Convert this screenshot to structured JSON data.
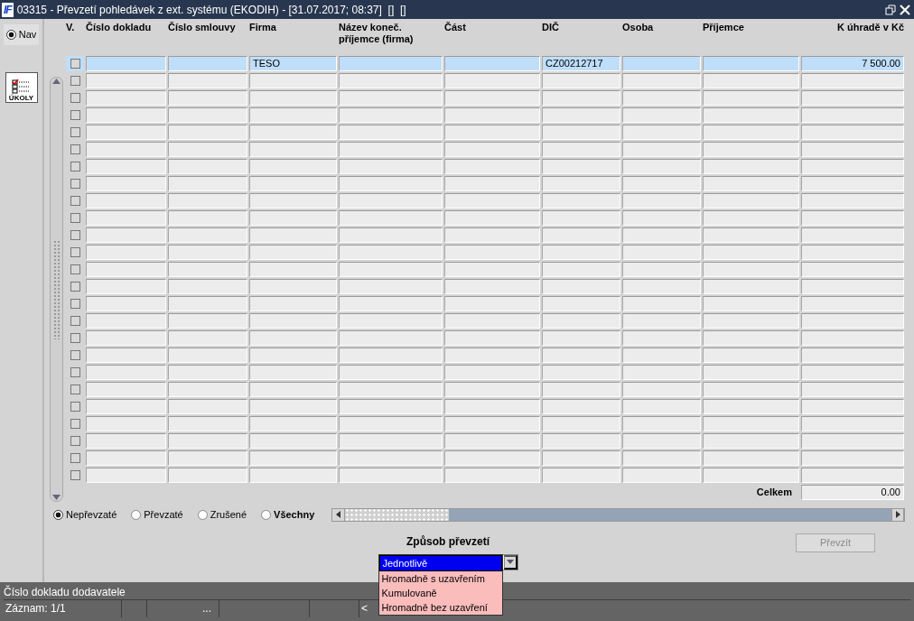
{
  "window": {
    "logo": "IF",
    "title": "03315 - Převzetí pohledávek z ext. systému (EKODIH) - [31.07.2017; 08:37]  []  []"
  },
  "sidebar": {
    "nav_radio": {
      "label": "Nav",
      "selected": true
    },
    "tasks_button": {
      "label": "ÚKOLY"
    }
  },
  "table": {
    "columns": [
      {
        "label": "V."
      },
      {
        "label": "Číslo dokladu"
      },
      {
        "label": "Číslo smlouvy"
      },
      {
        "label": "Firma"
      },
      {
        "label": "Název koneč. příjemce (firma)"
      },
      {
        "label": "Část"
      },
      {
        "label": "DIČ"
      },
      {
        "label": "Osoba"
      },
      {
        "label": "Příjemce"
      },
      {
        "label": "K úhradě v Kč"
      }
    ],
    "rows": [
      {
        "selected": true,
        "checked": false,
        "cells": {
          "Firma": "TESO",
          "DIČ": "CZ00212717",
          "K úhradě v Kč": "7 500.00"
        }
      },
      {
        "selected": false,
        "checked": false
      },
      {
        "selected": false,
        "checked": false
      },
      {
        "selected": false,
        "checked": false
      },
      {
        "selected": false,
        "checked": false
      },
      {
        "selected": false,
        "checked": false
      },
      {
        "selected": false,
        "checked": false
      },
      {
        "selected": false,
        "checked": false
      },
      {
        "selected": false,
        "checked": false
      },
      {
        "selected": false,
        "checked": false
      },
      {
        "selected": false,
        "checked": false
      },
      {
        "selected": false,
        "checked": false
      },
      {
        "selected": false,
        "checked": false
      },
      {
        "selected": false,
        "checked": false
      },
      {
        "selected": false,
        "checked": false
      },
      {
        "selected": false,
        "checked": false
      },
      {
        "selected": false,
        "checked": false
      },
      {
        "selected": false,
        "checked": false
      },
      {
        "selected": false,
        "checked": false
      },
      {
        "selected": false,
        "checked": false
      },
      {
        "selected": false,
        "checked": false
      },
      {
        "selected": false,
        "checked": false
      },
      {
        "selected": false,
        "checked": false
      },
      {
        "selected": false,
        "checked": false
      },
      {
        "selected": false,
        "checked": false
      }
    ],
    "total": {
      "label": "Celkem",
      "value": "0.00"
    }
  },
  "filters": [
    {
      "label": "Nepřevzaté",
      "selected": true,
      "bold": false
    },
    {
      "label": "Převzaté",
      "selected": false,
      "bold": false
    },
    {
      "label": "Zrušené",
      "selected": false,
      "bold": false
    },
    {
      "label": "Všechny",
      "selected": false,
      "bold": true
    }
  ],
  "transfer_mode": {
    "label": "Způsob převzetí",
    "expanded": true,
    "options": [
      {
        "label": "Jednotlivě",
        "selected": true
      },
      {
        "label": "Hromadně s uzavřením",
        "selected": false
      },
      {
        "label": "Kumulovaně",
        "selected": false
      },
      {
        "label": "Hromadně bez uzavření",
        "selected": false
      }
    ]
  },
  "transfer_button": {
    "label": "Převzít",
    "disabled": true
  },
  "status_bar": {
    "hint": "Číslo dokladu dodavatele",
    "record": "Záznam: 1/1",
    "segment_4": "...",
    "segment_7": "<"
  }
}
